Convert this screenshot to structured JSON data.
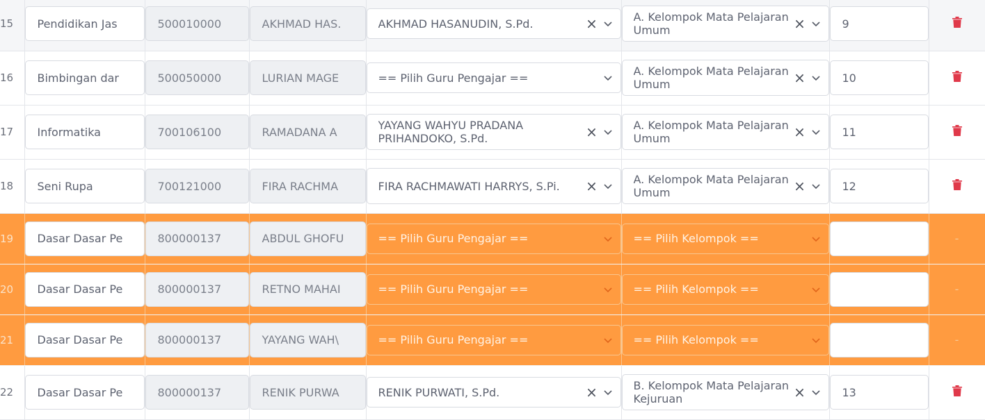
{
  "placeholders": {
    "teacher": "== Pilih Guru Pengajar ==",
    "group": "== Pilih Kelompok =="
  },
  "rows": [
    {
      "no": "15",
      "subject": "Pendidikan Jas",
      "code": "500010000",
      "teacher_short": "AKHMAD HAS.",
      "teacher": "AKHMAD HASANUDIN, S.Pd.",
      "group": "A. Kelompok Mata Pelajaran Umum",
      "order": "9"
    },
    {
      "no": "16",
      "subject": "Bimbingan dar",
      "code": "500050000",
      "teacher_short": "LURIAN MAGE",
      "teacher": "== Pilih Guru Pengajar ==",
      "group": "A. Kelompok Mata Pelajaran Umum",
      "order": "10"
    },
    {
      "no": "17",
      "subject": "Informatika",
      "code": "700106100",
      "teacher_short": "RAMADANA A",
      "teacher": "YAYANG WAHYU PRADANA PRIHANDOKO, S.Pd.",
      "group": "A. Kelompok Mata Pelajaran Umum",
      "order": "11"
    },
    {
      "no": "18",
      "subject": "Seni Rupa",
      "code": "700121000",
      "teacher_short": "FIRA RACHMA",
      "teacher": "FIRA RACHMAWATI HARRYS, S.Pi.",
      "group": "A. Kelompok Mata Pelajaran Umum",
      "order": "12"
    },
    {
      "no": "19",
      "subject": "Dasar Dasar Pe",
      "code": "800000137",
      "teacher_short": "ABDUL GHOFU",
      "teacher": "== Pilih Guru Pengajar ==",
      "group": "== Pilih Kelompok ==",
      "order": "",
      "action": "-"
    },
    {
      "no": "20",
      "subject": "Dasar Dasar Pe",
      "code": "800000137",
      "teacher_short": "RETNO MAHAI",
      "teacher": "== Pilih Guru Pengajar ==",
      "group": "== Pilih Kelompok ==",
      "order": "",
      "action": "-"
    },
    {
      "no": "21",
      "subject": "Dasar Dasar Pe",
      "code": "800000137",
      "teacher_short": "YAYANG WAH\\",
      "teacher": "== Pilih Guru Pengajar ==",
      "group": "== Pilih Kelompok ==",
      "order": "",
      "action": "-"
    },
    {
      "no": "22",
      "subject": "Dasar Dasar Pe",
      "code": "800000137",
      "teacher_short": "RENIK PURWA",
      "teacher": "RENIK PURWATI, S.Pd.",
      "group": "B. Kelompok Mata Pelajaran Kejuruan",
      "order": "13"
    }
  ],
  "colors": {
    "highlight": "#ff9b40",
    "trash": "#e0394a",
    "alt_row": "#f5f6f8"
  },
  "icons": {
    "clear": "close-icon",
    "chevron": "chevron-down-icon",
    "delete": "trash-icon"
  }
}
